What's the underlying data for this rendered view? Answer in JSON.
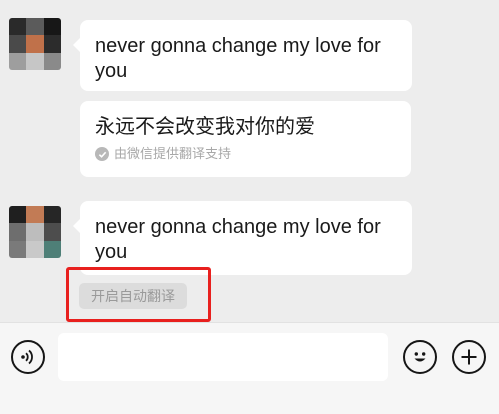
{
  "messages": [
    {
      "text": "never gonna change my love for you"
    },
    {
      "text": "永远不会改变我对你的爱",
      "note": "由微信提供翻译支持"
    },
    {
      "text": "never gonna change my love for you"
    }
  ],
  "auto_translate_label": "开启自动翻译",
  "input": {
    "value": "",
    "placeholder": ""
  },
  "icons": {
    "voice": "voice-icon",
    "emoji": "emoji-icon",
    "plus": "plus-icon",
    "check": "check-circle-icon"
  },
  "colors": {
    "chat_background": "#ededed",
    "bubble": "#ffffff",
    "highlight": "#e8201e",
    "input_bar": "#f6f6f6"
  }
}
